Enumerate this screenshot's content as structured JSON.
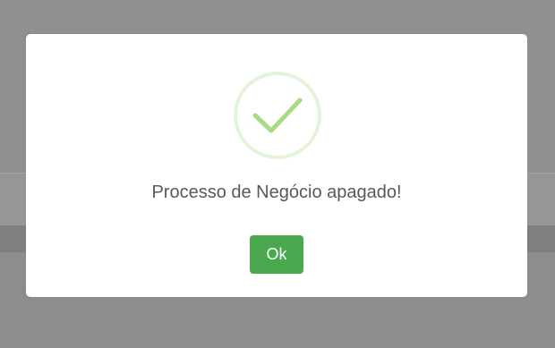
{
  "dialog": {
    "icon": "success-checkmark-icon",
    "message": "Processo de Negócio apagado!",
    "ok_label": "Ok"
  },
  "colors": {
    "overlay": "#8f9092",
    "check": "#a5dc86",
    "ok_button": "#4aa84f",
    "message_text": "#595959"
  }
}
